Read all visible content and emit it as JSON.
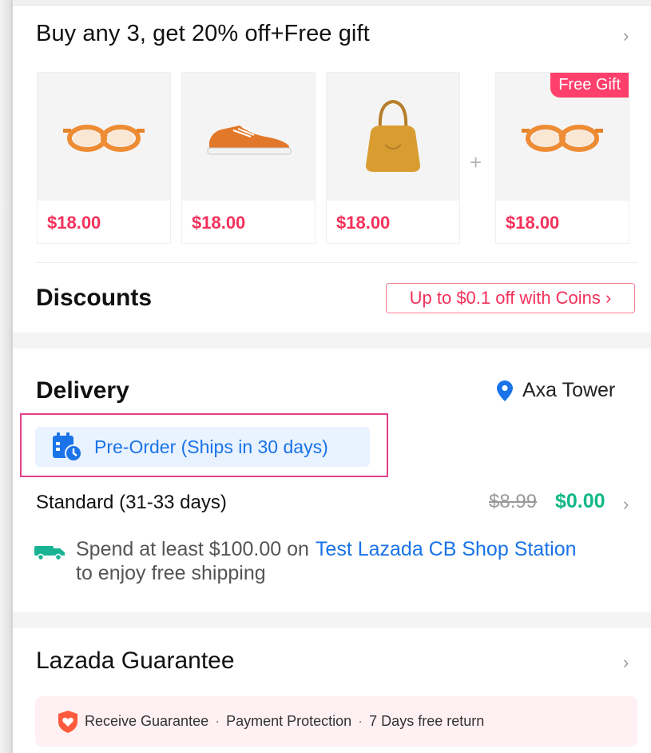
{
  "promo": {
    "title": "Buy any 3, get 20% off+Free gift",
    "chevron": "›",
    "products": [
      {
        "icon": "glasses-icon",
        "price": "$18.00"
      },
      {
        "icon": "sneaker-icon",
        "price": "$18.00"
      },
      {
        "icon": "handbag-icon",
        "price": "$18.00"
      },
      {
        "icon": "glasses-icon",
        "price": "$18.00",
        "badge": "Free Gift"
      }
    ],
    "plus": "+"
  },
  "discounts": {
    "title": "Discounts",
    "coins_tag": "Up to $0.1 off with Coins ›"
  },
  "delivery": {
    "title": "Delivery",
    "location": "Axa Tower",
    "preorder": "Pre-Order (Ships in 30 days)",
    "standard": "Standard (31-33 days)",
    "old_price": "$8.99",
    "new_price": "$0.00",
    "chevron": "›",
    "free_shipping_prefix": "Spend at least $100.00 on",
    "free_shipping_shop": "Test Lazada CB Shop Station",
    "free_shipping_suffix": "to enjoy free shipping"
  },
  "guarantee": {
    "title": "Lazada Guarantee",
    "chevron": "›",
    "item1": "Receive Guarantee",
    "item2": "Payment Protection",
    "item3": "7 Days free return",
    "dot": "·"
  },
  "colors": {
    "price": "#f5305a",
    "free_price": "#12b886",
    "link": "#1a73e8",
    "badge": "#ff3f6c"
  }
}
